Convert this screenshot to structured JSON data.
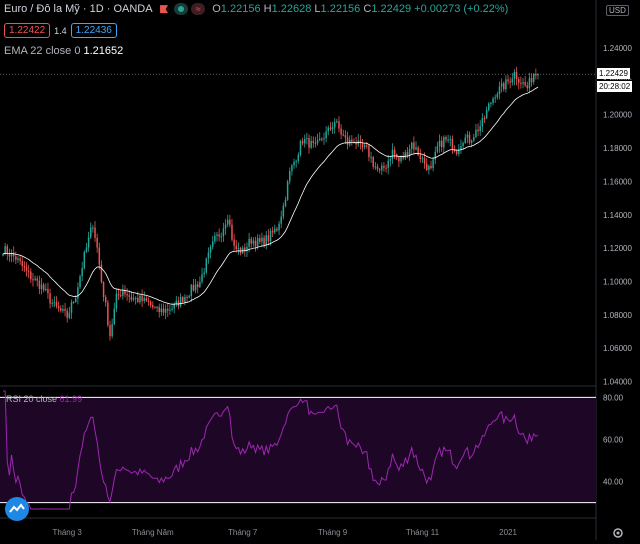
{
  "header": {
    "symbol": "Euro / Đô la Mỹ",
    "interval": "1D",
    "exchange": "OANDA",
    "ohlc": {
      "o_label": "O",
      "o": "1.22156",
      "h_label": "H",
      "h": "1.22628",
      "l_label": "L",
      "l": "1.22156",
      "c_label": "C",
      "c": "1.22429",
      "change": "+0.00273 (+0.22%)"
    },
    "sell_price": "1.22422",
    "spread": "1.4",
    "buy_price": "1.22436",
    "ema_label": "EMA 22 close 0",
    "ema_value": "1.21652"
  },
  "currency": "USD",
  "last_price_tag": "1.22429",
  "countdown_tag": "20:28:02",
  "rsi": {
    "label": "RSI 20 close",
    "value": "61.99"
  },
  "colors": {
    "up": "#26a69a",
    "down": "#ef5350",
    "rsi_line": "#9c27b0",
    "rsi_band": "#1e0726",
    "ema_line": "#ffffff",
    "background": "#000000"
  },
  "icons": [
    "flag-icon",
    "market-status-icon",
    "compare-icon",
    "tradingview-logo-icon",
    "settings-icon"
  ],
  "chart_data": [
    {
      "type": "candlestick",
      "title": "Euro / Đô la Mỹ · 1D · OANDA",
      "y_ticks": [
        "1.24000",
        "1.22000",
        "1.20000",
        "1.18000",
        "1.16000",
        "1.14000",
        "1.12000",
        "1.10000",
        "1.08000",
        "1.06000",
        "1.04000"
      ],
      "ylim": [
        1.04,
        1.245
      ],
      "x_ticks": [
        "Tháng 3",
        "Tháng Năm",
        "Tháng 7",
        "Tháng 9",
        "Tháng 11",
        "2021"
      ],
      "x_tick_index": [
        30,
        70,
        112,
        154,
        196,
        236
      ],
      "close_anchors": [
        [
          0,
          1.1195
        ],
        [
          6,
          1.114
        ],
        [
          12,
          1.104
        ],
        [
          18,
          1.097
        ],
        [
          24,
          1.085
        ],
        [
          30,
          1.079
        ],
        [
          34,
          1.092
        ],
        [
          38,
          1.115
        ],
        [
          40,
          1.125
        ],
        [
          42,
          1.135
        ],
        [
          44,
          1.12
        ],
        [
          46,
          1.1
        ],
        [
          48,
          1.085
        ],
        [
          50,
          1.068
        ],
        [
          53,
          1.09
        ],
        [
          56,
          1.095
        ],
        [
          60,
          1.09
        ],
        [
          64,
          1.089
        ],
        [
          68,
          1.087
        ],
        [
          72,
          1.082
        ],
        [
          76,
          1.083
        ],
        [
          80,
          1.085
        ],
        [
          84,
          1.09
        ],
        [
          88,
          1.095
        ],
        [
          92,
          1.1
        ],
        [
          96,
          1.115
        ],
        [
          99,
          1.125
        ],
        [
          102,
          1.13
        ],
        [
          105,
          1.14
        ],
        [
          108,
          1.12
        ],
        [
          112,
          1.118
        ],
        [
          116,
          1.125
        ],
        [
          120,
          1.123
        ],
        [
          124,
          1.126
        ],
        [
          128,
          1.132
        ],
        [
          131,
          1.145
        ],
        [
          134,
          1.165
        ],
        [
          137,
          1.175
        ],
        [
          140,
          1.185
        ],
        [
          143,
          1.183
        ],
        [
          146,
          1.18
        ],
        [
          149,
          1.186
        ],
        [
          152,
          1.19
        ],
        [
          155,
          1.196
        ],
        [
          158,
          1.189
        ],
        [
          161,
          1.183
        ],
        [
          164,
          1.185
        ],
        [
          167,
          1.18
        ],
        [
          170,
          1.179
        ],
        [
          173,
          1.171
        ],
        [
          176,
          1.165
        ],
        [
          179,
          1.17
        ],
        [
          182,
          1.178
        ],
        [
          185,
          1.172
        ],
        [
          188,
          1.176
        ],
        [
          191,
          1.183
        ],
        [
          194,
          1.177
        ],
        [
          197,
          1.171
        ],
        [
          200,
          1.166
        ],
        [
          203,
          1.18
        ],
        [
          206,
          1.185
        ],
        [
          209,
          1.183
        ],
        [
          212,
          1.179
        ],
        [
          215,
          1.186
        ],
        [
          218,
          1.185
        ],
        [
          221,
          1.19
        ],
        [
          224,
          1.195
        ],
        [
          227,
          1.205
        ],
        [
          230,
          1.213
        ],
        [
          233,
          1.216
        ],
        [
          236,
          1.22
        ],
        [
          239,
          1.225
        ],
        [
          242,
          1.22
        ],
        [
          245,
          1.216
        ],
        [
          248,
          1.225
        ],
        [
          250,
          1.2243
        ]
      ],
      "last_close": 1.22429,
      "ema_last": 1.21652
    },
    {
      "type": "line",
      "title": "RSI 20 close",
      "y_ticks": [
        "80.00",
        "60.00",
        "40.00"
      ],
      "ylim": [
        27,
        83
      ],
      "bands": [
        80,
        30
      ],
      "last_value": 61.99
    }
  ]
}
